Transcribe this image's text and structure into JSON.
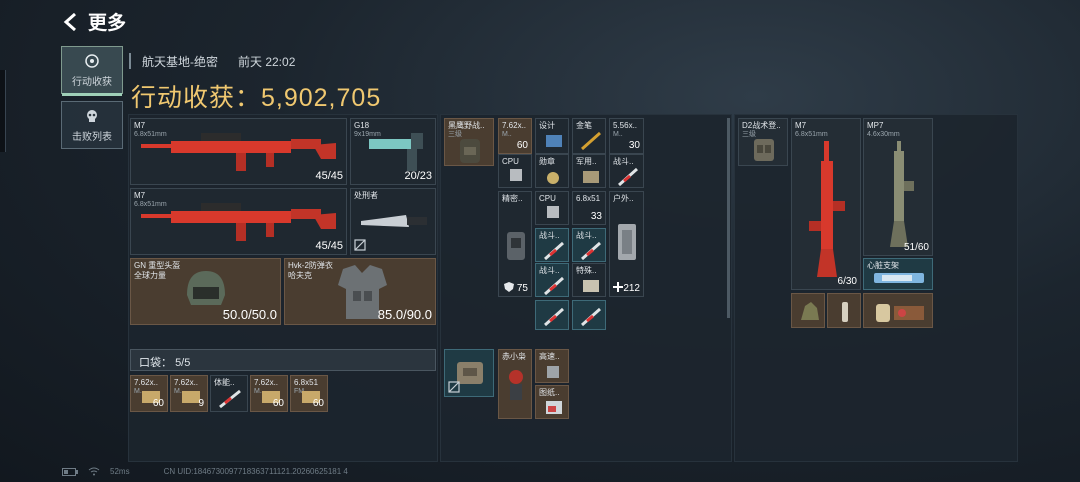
{
  "back": {
    "label": "更多"
  },
  "tabs": [
    {
      "label": "行动收获",
      "icon": "target-icon",
      "active": true
    },
    {
      "label": "击败列表",
      "icon": "skull-icon",
      "active": false
    }
  ],
  "header": {
    "map": "航天基地-绝密",
    "time": "前天 22:02"
  },
  "title": "行动收获：5,902,705",
  "loadout": {
    "weapon1": {
      "name": "M7",
      "caliber": "6.8x51mm",
      "ammo": "45/45"
    },
    "weapon2": {
      "name": "M7",
      "caliber": "6.8x51mm",
      "ammo": "45/45"
    },
    "pistol": {
      "name": "G18",
      "caliber": "9x19mm",
      "ammo": "20/23"
    },
    "melee": {
      "name": "处刑者"
    },
    "helmet": {
      "name": "GN 重型头盔",
      "sub": "全球力量",
      "durability": "50.0/50.0"
    },
    "armor": {
      "name": "Hvk-2防弹衣",
      "sub": "哈夫克",
      "durability": "85.0/90.0"
    }
  },
  "pocket": {
    "label": "口袋：",
    "count": "5/5"
  },
  "pocket_items": [
    {
      "label": "7.62x..",
      "sub": "M..",
      "qty": "60"
    },
    {
      "label": "7.62x..",
      "sub": "M..",
      "qty": "9"
    },
    {
      "label": "体能..",
      "sub": "",
      "qty": ""
    },
    {
      "label": "7.62x..",
      "sub": "M..",
      "qty": "60"
    },
    {
      "label": "6.8x51",
      "sub": "FM..",
      "qty": "60"
    }
  ],
  "backpack": {
    "bag_label": "黑鹰野战..",
    "bag_sub": "三级",
    "items": [
      {
        "label": "7.62x..",
        "sub": "M..",
        "qty": "60"
      },
      {
        "label": "设计",
        "qty": ""
      },
      {
        "label": "金笔",
        "qty": ""
      },
      {
        "label": "5.56x..",
        "sub": "M..",
        "qty": "30"
      },
      {
        "label": "CPU",
        "qty": ""
      },
      {
        "label": "勋章",
        "qty": ""
      },
      {
        "label": "军用..",
        "qty": ""
      },
      {
        "label": "战斗..",
        "qty": ""
      },
      {
        "label": "精密..",
        "qty": "75"
      },
      {
        "label": "CPU",
        "qty": ""
      },
      {
        "label": "6.8x51",
        "qty": "33"
      },
      {
        "label": "户外..",
        "qty": "212"
      },
      {
        "label": "战斗..",
        "qty": ""
      },
      {
        "label": "战斗..",
        "qty": ""
      },
      {
        "label": "战斗..",
        "qty": ""
      },
      {
        "label": "特殊..",
        "qty": ""
      }
    ]
  },
  "case": {
    "items": [
      {
        "label": "赤小枭"
      },
      {
        "label": "高速.."
      },
      {
        "label": "图纸.."
      }
    ]
  },
  "rig": {
    "rig_label": "D2战术登..",
    "rig_sub": "三级",
    "weapon1": {
      "name": "M7",
      "caliber": "6.8x51mm",
      "ammo": "6/30"
    },
    "weapon2": {
      "name": "MP7",
      "caliber": "4.6x30mm",
      "ammo": "51/60"
    },
    "medkit": {
      "label": "心脏支架"
    }
  },
  "status": {
    "ping": "52ms",
    "uid": "CN UID:1846730097718363711121.20260625181 4"
  }
}
